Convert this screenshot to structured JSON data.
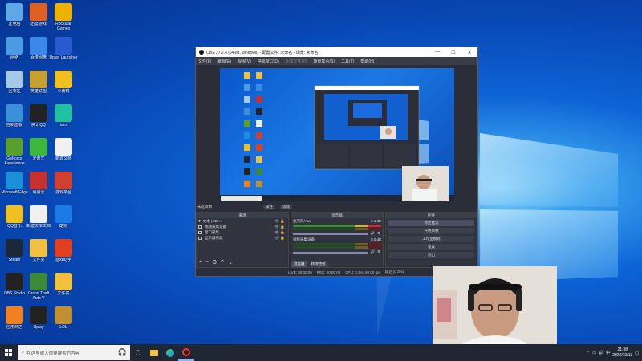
{
  "desktop": {
    "columns": [
      [
        {
          "label": "此电脑",
          "icon": "computer-icon",
          "color": "#5fa8e8"
        },
        {
          "label": "网络",
          "icon": "network-icon",
          "color": "#4b9be0"
        },
        {
          "label": "回收站",
          "icon": "recycle-bin-icon",
          "color": "#a8c8e8"
        },
        {
          "label": "控制面板",
          "icon": "control-panel-icon",
          "color": "#3b8fd8"
        },
        {
          "label": "GeForce Experience",
          "icon": "nvidia-icon",
          "color": "#5a9e2f"
        },
        {
          "label": "Microsoft Edge",
          "icon": "edge-icon",
          "color": "#1b8fd8"
        },
        {
          "label": "QQ音乐",
          "icon": "qq-music-icon",
          "color": "#f0c020"
        },
        {
          "label": "Steam",
          "icon": "steam-icon",
          "color": "#1b2838"
        },
        {
          "label": "OBS Studio",
          "icon": "obs-icon",
          "color": "#222"
        },
        {
          "label": "应用商店",
          "icon": "store-icon",
          "color": "#f08020"
        }
      ],
      [
        {
          "label": "迅雷游戏",
          "icon": "game-icon",
          "color": "#e06020"
        },
        {
          "label": "百度网盘",
          "icon": "baidu-icon",
          "color": "#3a88e8"
        },
        {
          "label": "英雄联盟",
          "icon": "lol-icon",
          "color": "#c8a030"
        },
        {
          "label": "腾讯QQ",
          "icon": "qq-icon",
          "color": "#222"
        },
        {
          "label": "爱奇艺",
          "icon": "iqiyi-icon",
          "color": "#3cb83c"
        },
        {
          "label": "网易云",
          "icon": "netease-icon",
          "color": "#c83030"
        },
        {
          "label": "新建文本文档",
          "icon": "text-file-icon",
          "color": "#f0f0f0"
        },
        {
          "label": "文件夹",
          "icon": "folder-icon",
          "color": "#f0c040"
        },
        {
          "label": "Grand Theft Auto V",
          "icon": "gta-icon",
          "color": "#3a8a3a"
        },
        {
          "label": "Uplay",
          "icon": "uplay-icon",
          "color": "#222"
        }
      ],
      [
        {
          "label": "Rockstar Games",
          "icon": "rockstar-icon",
          "color": "#f0b000"
        },
        {
          "label": "Uplay Launcher",
          "icon": "uplay-launcher-icon",
          "color": "#2a5ad0"
        },
        {
          "label": "小黄鸭",
          "icon": "duck-icon",
          "color": "#f0c020"
        },
        {
          "label": "iam",
          "icon": "iam-icon",
          "color": "#20c0a0"
        },
        {
          "label": "新建文档",
          "icon": "document-icon",
          "color": "#f0f0f0"
        },
        {
          "label": "游戏平台",
          "icon": "platform-icon",
          "color": "#d04030"
        },
        {
          "label": "酷狗",
          "icon": "kugou-icon",
          "color": "#1a7ae8"
        },
        {
          "label": "游戏助手",
          "icon": "helper-icon",
          "color": "#e04020"
        },
        {
          "label": "文件夹",
          "icon": "folder2-icon",
          "color": "#f0c040"
        },
        {
          "label": "LOL",
          "icon": "league-icon",
          "color": "#c09030"
        }
      ]
    ]
  },
  "obs": {
    "title": "OBS 27.2.4 (64-bit, windows) - 配置文件: 未命名 - 场景: 未命名",
    "menu": [
      "文件(F)",
      "编辑(E)",
      "视图(V)",
      "停靠窗口(D)",
      "配置文件(P)",
      "场景集合(S)",
      "工具(T)",
      "帮助(H)"
    ],
    "preview_bar": {
      "label": "未选择源",
      "prop": "属性",
      "filter": "滤镜"
    },
    "sources": {
      "header": "来源",
      "items": [
        "文本 (GDI+)",
        "视频采集设备",
        "窗口采集",
        "显示器采集"
      ]
    },
    "mixer": {
      "header": "混音器",
      "channels": [
        {
          "name": "麦克风/Aux",
          "db": "-6.4 dB"
        },
        {
          "name": "视频采集设备",
          "db": "0.0 dB"
        }
      ],
      "tabs": [
        "混音器",
        "转场特效"
      ]
    },
    "controls": {
      "header": "控件",
      "buttons": [
        "停止推流",
        "开始录制",
        "工作室模式",
        "设置",
        "退出"
      ]
    },
    "status": {
      "live": "LIVE: 00:00:00",
      "rec": "REC: 00:00:00",
      "cpu": "CPU: 3.2%, 60.00 fps",
      "dropped": "延迟 (0.0%)"
    }
  },
  "taskbar": {
    "search_placeholder": "在这里输入你要搜索的内容",
    "time": "21:38",
    "date": "2022/10/13"
  },
  "colors": {
    "taskbar": "#1f2735",
    "obs_bg": "#2b2e38",
    "accent": "#0d63d6"
  }
}
